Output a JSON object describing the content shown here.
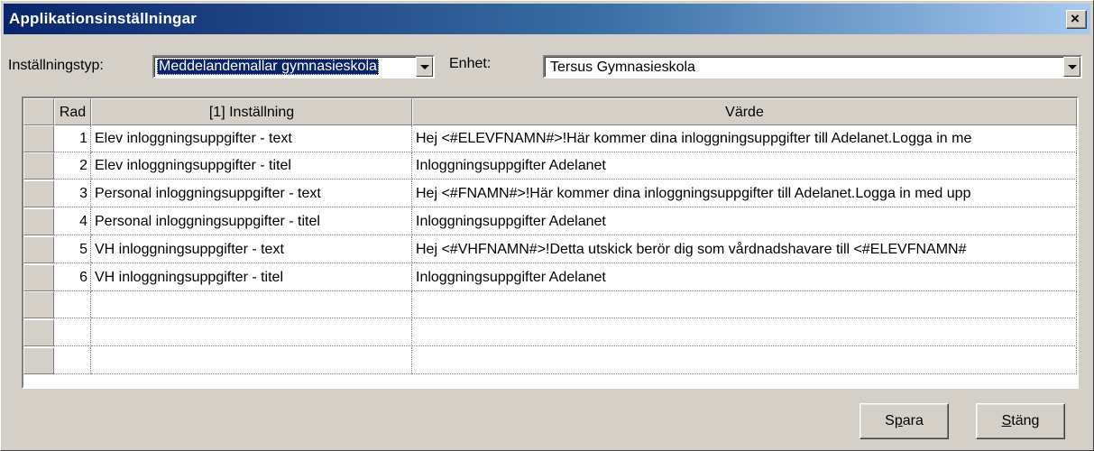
{
  "window": {
    "title": "Applikationsinställningar",
    "close_glyph": "×"
  },
  "filters": {
    "type_label": "Inställningstyp:",
    "type_value": "Meddelandemallar gymnasieskola",
    "unit_label": "Enhet:",
    "unit_value": "Tersus Gymnasieskola"
  },
  "grid": {
    "headers": [
      "Rad",
      "[1] Inställning",
      "Värde"
    ],
    "rows": [
      {
        "rad": "1",
        "setting": "Elev inloggningsuppgifter - text",
        "value": "Hej <#ELEVFNAMN#>!Här kommer dina inloggningsuppgifter till Adelanet.Logga in me"
      },
      {
        "rad": "2",
        "setting": "Elev inloggningsuppgifter - titel",
        "value": "Inloggningsuppgifter Adelanet"
      },
      {
        "rad": "3",
        "setting": "Personal inloggningsuppgifter - text",
        "value": "Hej <#FNAMN#>!Här kommer dina inloggningsuppgifter till Adelanet.Logga in med upp"
      },
      {
        "rad": "4",
        "setting": "Personal inloggningsuppgifter - titel",
        "value": "Inloggningsuppgifter Adelanet"
      },
      {
        "rad": "5",
        "setting": "VH inloggningsuppgifter - text",
        "value": "Hej <#VHFNAMN#>!Detta utskick berör dig som vårdnadshavare till <#ELEVFNAMN#"
      },
      {
        "rad": "6",
        "setting": "VH inloggningsuppgifter - titel",
        "value": "Inloggningsuppgifter Adelanet"
      }
    ],
    "empty_rows": 3
  },
  "buttons": {
    "save_pre": "S",
    "save_key": "p",
    "save_post": "ara",
    "close_pre": "",
    "close_key": "S",
    "close_post": "täng"
  }
}
